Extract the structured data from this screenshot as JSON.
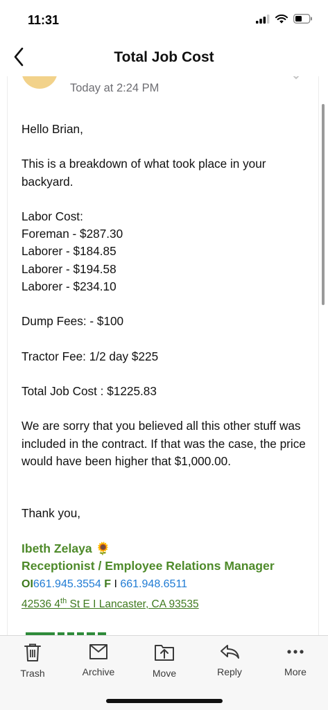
{
  "status_bar": {
    "time": "11:31"
  },
  "nav": {
    "title": "Total Job Cost"
  },
  "email": {
    "date": "Today at 2:24 PM",
    "greeting": "Hello Brian,",
    "intro": "This is a breakdown of what took place in your backyard.",
    "labor_heading": "Labor Cost:",
    "labor_items": [
      "Foreman - $287.30",
      "Laborer - $184.85",
      "Laborer - $194.58",
      "Laborer - $234.10"
    ],
    "dump_fees": "Dump Fees: - $100",
    "tractor_fee": "Tractor Fee: 1/2 day $225",
    "total": "Total Job Cost : $1225.83",
    "apology": "We are sorry that you believed all this other stuff was included in the contract. If that was the case, the price would have been higher that $1,000.00.",
    "closing": "Thank you,"
  },
  "signature": {
    "name": "Ibeth Zelaya",
    "emoji": "🌻",
    "role": "Receptionist / Employee Relations Manager",
    "office_label": "O",
    "office_sep": "I",
    "office_number": "661.945.3554",
    "fax_label": "F",
    "fax_sep": "I",
    "fax_number": "661.948.6511",
    "address_number": "42536 4",
    "address_suffix": "th",
    "address_rest": " St E I Lancaster, CA 93535"
  },
  "toolbar": {
    "trash": "Trash",
    "archive": "Archive",
    "move": "Move",
    "reply": "Reply",
    "more": "More"
  },
  "colors": {
    "signature_green": "#4e8a2a",
    "link_blue": "#1f7bd4",
    "avatar": "#f2d28a",
    "toolbar_icon": "#3a3a3a"
  }
}
